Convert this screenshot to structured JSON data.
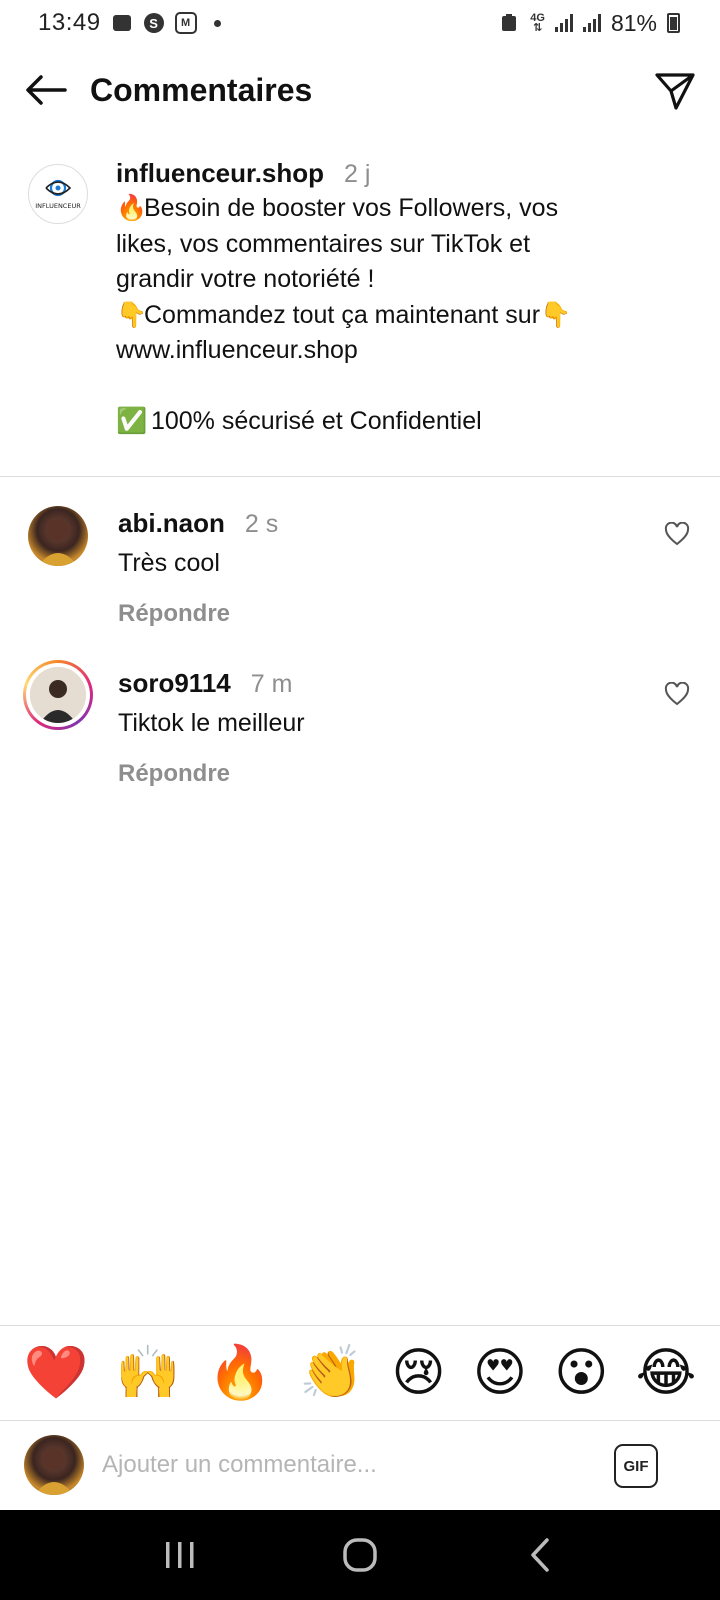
{
  "status_bar": {
    "time": "13:49",
    "battery_percent": "81%",
    "network": "4G"
  },
  "header": {
    "title": "Commentaires",
    "back_icon": "arrow-left-icon",
    "send_icon": "paper-plane-icon"
  },
  "caption": {
    "username": "influenceur.shop",
    "time": "2 j",
    "avatar_label": "INFLUENCEUR",
    "lines": [
      {
        "emoji": "🔥",
        "text": "Besoin de booster vos Followers, vos"
      },
      {
        "emoji": "",
        "text": "likes, vos commentaires sur TikTok et"
      },
      {
        "emoji": "",
        "text": "grandir votre notoriété !"
      },
      {
        "emoji": "👇",
        "text": "Commandez tout ça maintenant sur",
        "emoji_end": "👇"
      },
      {
        "emoji": "",
        "text": " www.influenceur.shop"
      },
      {
        "emoji": "",
        "text": ""
      },
      {
        "emoji": "✅",
        "text": " 100% sécurisé et Confidentiel"
      }
    ]
  },
  "comments": [
    {
      "username": "abi.naon",
      "time": "2 s",
      "text": "Très cool",
      "reply_label": "Répondre"
    },
    {
      "username": "soro9114",
      "time": "7 m",
      "text": "Tiktok le meilleur",
      "reply_label": "Répondre"
    }
  ],
  "emoji_bar": [
    "❤️",
    "🙌",
    "🔥",
    "👏",
    "😢",
    "😍",
    "😮",
    "😂"
  ],
  "input": {
    "placeholder": "Ajouter un commentaire...",
    "gif_label": "GIF"
  },
  "colors": {
    "text": "#111111",
    "muted": "#8e8e8e",
    "divider": "#dcdcdc",
    "nav_bar": "#000000"
  }
}
